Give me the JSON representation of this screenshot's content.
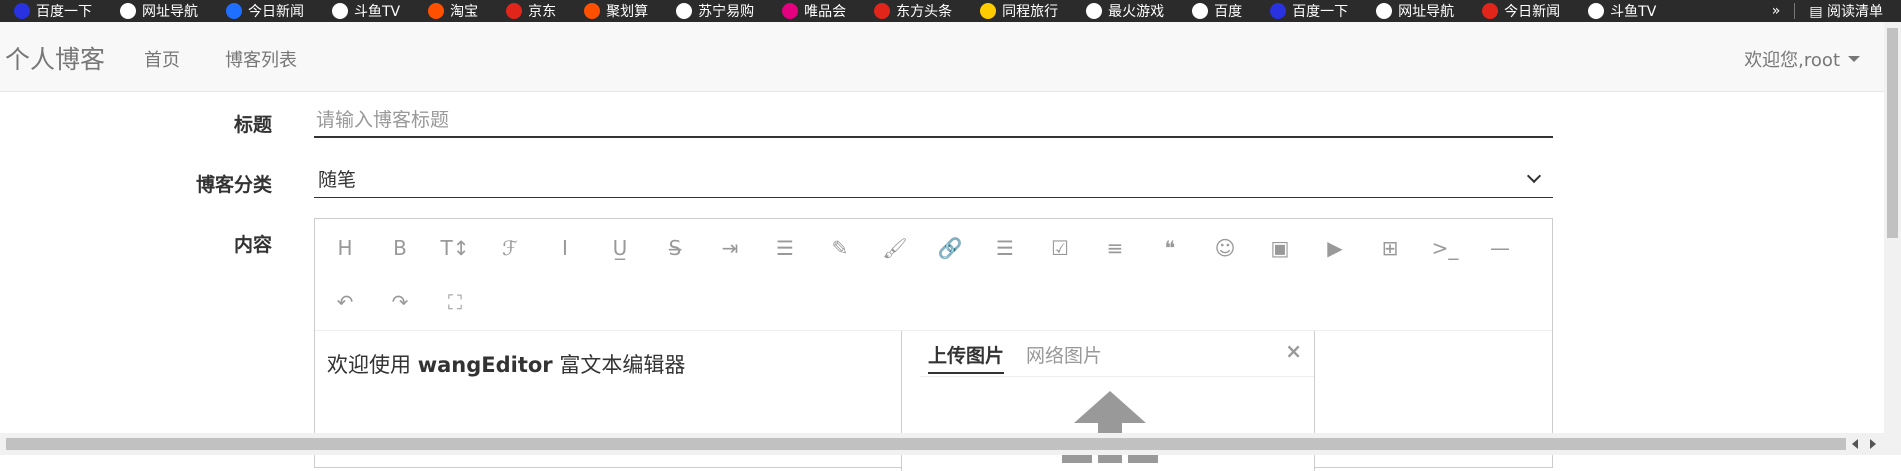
{
  "bookmarks": {
    "items": [
      {
        "label": "百度一下",
        "icon": "baidu-icon",
        "color": "#2932e1"
      },
      {
        "label": "网址导航",
        "icon": "globe-icon",
        "color": "#ffffff"
      },
      {
        "label": "今日新闻",
        "icon": "news-icon",
        "color": "#1e6fff"
      },
      {
        "label": "斗鱼TV",
        "icon": "globe-icon",
        "color": "#ffffff"
      },
      {
        "label": "淘宝",
        "icon": "taobao-icon",
        "color": "#ff5000"
      },
      {
        "label": "京东",
        "icon": "jd-icon",
        "color": "#e1251b"
      },
      {
        "label": "聚划算",
        "icon": "juhuasuan-icon",
        "color": "#ff5000"
      },
      {
        "label": "苏宁易购",
        "icon": "globe-icon",
        "color": "#ffffff"
      },
      {
        "label": "唯品会",
        "icon": "vip-icon",
        "color": "#e4007f"
      },
      {
        "label": "东方头条",
        "icon": "toutiao-icon",
        "color": "#e1251b"
      },
      {
        "label": "同程旅行",
        "icon": "travel-icon",
        "color": "#ffcc00"
      },
      {
        "label": "最火游戏",
        "icon": "globe-icon",
        "color": "#ffffff"
      },
      {
        "label": "百度",
        "icon": "globe-icon",
        "color": "#ffffff"
      },
      {
        "label": "百度一下",
        "icon": "baidu-icon",
        "color": "#2932e1"
      },
      {
        "label": "网址导航",
        "icon": "globe-icon",
        "color": "#ffffff"
      },
      {
        "label": "今日新闻",
        "icon": "toutiao-icon",
        "color": "#e1251b"
      },
      {
        "label": "斗鱼TV",
        "icon": "globe-icon",
        "color": "#ffffff"
      }
    ],
    "more": "»",
    "reading_list": "阅读清单"
  },
  "navbar": {
    "brand": "个人博客",
    "links": [
      "首页",
      "博客列表"
    ],
    "user": "欢迎您,root"
  },
  "form": {
    "title_label": "标题",
    "title_placeholder": "请输入博客标题",
    "category_label": "博客分类",
    "category_value": "随笔",
    "content_label": "内容"
  },
  "editor": {
    "content_prefix": "欢迎使用 ",
    "content_bold": "wangEditor",
    "content_suffix": " 富文本编辑器",
    "toolbar": [
      "header-icon",
      "bold-icon",
      "font-size-icon",
      "font-family-icon",
      "italic-icon",
      "underline-icon",
      "strikethrough-icon",
      "indent-icon",
      "line-height-icon",
      "font-color-icon",
      "background-color-icon",
      "link-icon",
      "list-icon",
      "todo-icon",
      "justify-icon",
      "quote-icon",
      "emoticon-icon",
      "image-icon",
      "video-icon",
      "table-icon",
      "code-icon",
      "split-line-icon",
      "undo-icon",
      "redo-icon",
      "fullscreen-icon"
    ],
    "upload_tab_active": "上传图片",
    "upload_tab_inactive": "网络图片",
    "close": "×"
  }
}
